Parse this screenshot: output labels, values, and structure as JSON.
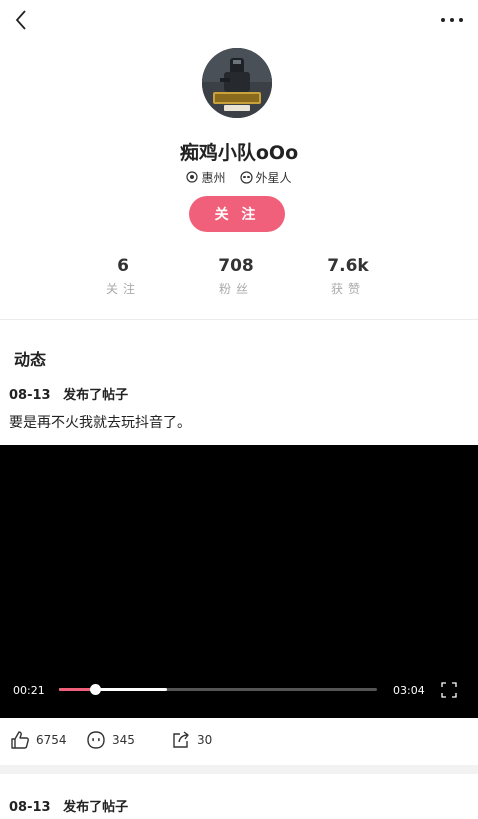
{
  "profile": {
    "username": "痴鸡小队oOo",
    "location": "惠州",
    "tag": "外星人",
    "follow_label": "关 注",
    "avatar_badge": "刺激战场"
  },
  "stats": [
    {
      "value": "6",
      "label": "关注"
    },
    {
      "value": "708",
      "label": "粉丝"
    },
    {
      "value": "7.6k",
      "label": "获赞"
    }
  ],
  "feed": {
    "section_title": "动态",
    "posts": [
      {
        "date": "08-13",
        "action": "发布了帖子",
        "text": "要是再不火我就去玩抖音了。",
        "video": {
          "current_time": "00:21",
          "duration": "03:04",
          "progress": 0.114,
          "buffered": 0.34
        },
        "likes": "6754",
        "comments": "345",
        "shares": "30"
      },
      {
        "date": "08-13",
        "action": "发布了帖子"
      }
    ]
  },
  "colors": {
    "accent": "#f0607a",
    "video_bg": "#000000",
    "muted": "#aaaaaa"
  },
  "icons": {
    "back": "chevron-left-icon",
    "more": "more-dots-icon",
    "location": "location-pin-icon",
    "tag": "alien-icon",
    "like": "thumbs-up-icon",
    "comment": "comment-face-icon",
    "share": "share-icon",
    "fullscreen": "fullscreen-icon"
  }
}
